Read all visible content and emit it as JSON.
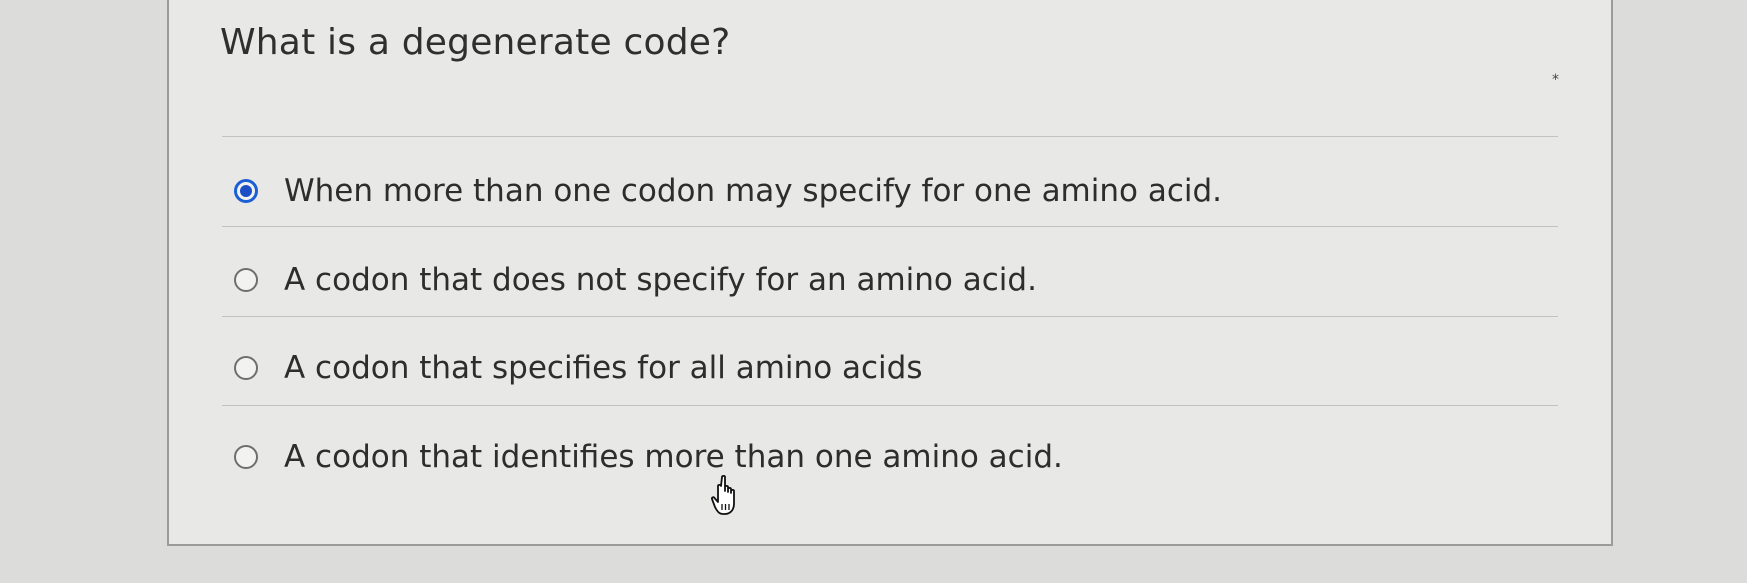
{
  "question": {
    "text": "What is a degenerate code?"
  },
  "corner_mark": "*",
  "options": [
    {
      "label": "When more than one codon may specify for one amino acid.",
      "selected": true
    },
    {
      "label": "A codon that does not specify for an amino acid.",
      "selected": false
    },
    {
      "label": "A codon that specifies for all amino acids",
      "selected": false
    },
    {
      "label": "A codon that identifies more than one amino acid.",
      "selected": false
    }
  ],
  "colors": {
    "selected_radio": "#1b4fc6",
    "background": "#dcdcda",
    "card": "#e8e8e6"
  },
  "icons": {
    "cursor": "hand-pointer-icon"
  }
}
